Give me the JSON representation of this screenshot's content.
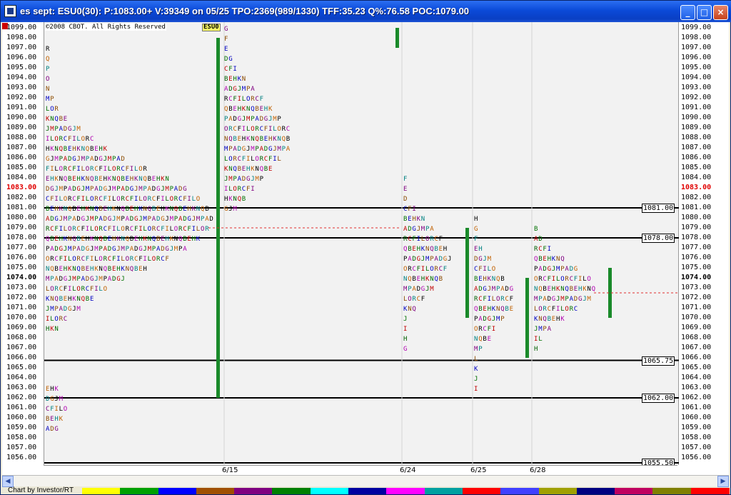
{
  "window": {
    "title": "es sept: ESU0(30): P:1083.00+ V:39349 on 05/25 TPO:2369(989/1330) TFF:35.23 Q%:76.58 POC:1079.00",
    "minimize_glyph": "_",
    "maximize_glyph": "□",
    "close_glyph": "×"
  },
  "chart": {
    "copyright": "©2008 CBOT. All Rights Reserved",
    "symbol_tag": "ESU0",
    "price_axis": {
      "prices": [
        "1099.00",
        "1098.00",
        "1097.00",
        "1096.00",
        "1095.00",
        "1094.00",
        "1093.00",
        "1092.00",
        "1091.00",
        "1090.00",
        "1089.00",
        "1088.00",
        "1087.00",
        "1086.00",
        "1085.00",
        "1084.00",
        "1083.00",
        "1082.00",
        "1081.00",
        "1080.00",
        "1079.00",
        "1078.00",
        "1077.00",
        "1076.00",
        "1075.00",
        "1074.00",
        "1073.00",
        "1072.00",
        "1071.00",
        "1070.00",
        "1069.00",
        "1068.00",
        "1067.00",
        "1066.00",
        "1065.00",
        "1064.00",
        "1063.00",
        "1062.00",
        "1061.00",
        "1060.00",
        "1059.00",
        "1058.00",
        "1057.00",
        "1056.00"
      ],
      "highlight_current": "1083.00",
      "highlight_bold": "1074.00"
    },
    "reference_lines": [
      {
        "label": "1081.00",
        "price": 1081.0
      },
      {
        "label": "1078.00",
        "price": 1078.0
      },
      {
        "label": "1065.75",
        "price": 1065.75
      },
      {
        "label": "1062.00",
        "price": 1062.0
      },
      {
        "label": "1055.50",
        "price": 1055.5
      }
    ],
    "dates": [
      "6/15",
      "6/24",
      "6/25",
      "6/28"
    ],
    "colors": {
      "value_area_bar": "#1a8a2a",
      "reference_line": "#000000",
      "poc_dashed": "#e03030",
      "highlight_price": "#e00000"
    }
  },
  "footer": {
    "text": "Chart by Investor/RT",
    "color_strip": [
      "#ffff00",
      "#00a000",
      "#0000ff",
      "#a05000",
      "#800080",
      "#008000",
      "#00ffff",
      "#0000a0",
      "#ff00ff",
      "#00a0a0",
      "#ff0000",
      "#4040ff",
      "#a0a000",
      "#000080",
      "#c00060",
      "#808000",
      "#ff0000"
    ]
  }
}
